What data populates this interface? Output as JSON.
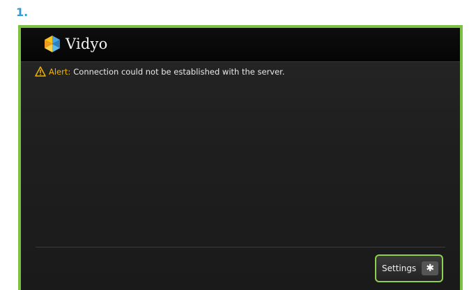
{
  "step": {
    "number": "1."
  },
  "app": {
    "name": "Vidyo"
  },
  "alert": {
    "label": "Alert:",
    "message": "Connection could not be established with the server."
  },
  "footer": {
    "settings_label": "Settings",
    "settings_icon": "gear-icon"
  },
  "colors": {
    "step_number": "#2f9bd6",
    "frame_border": "#7cc142",
    "alert_label": "#f0b400",
    "button_border": "#8fd14a"
  }
}
